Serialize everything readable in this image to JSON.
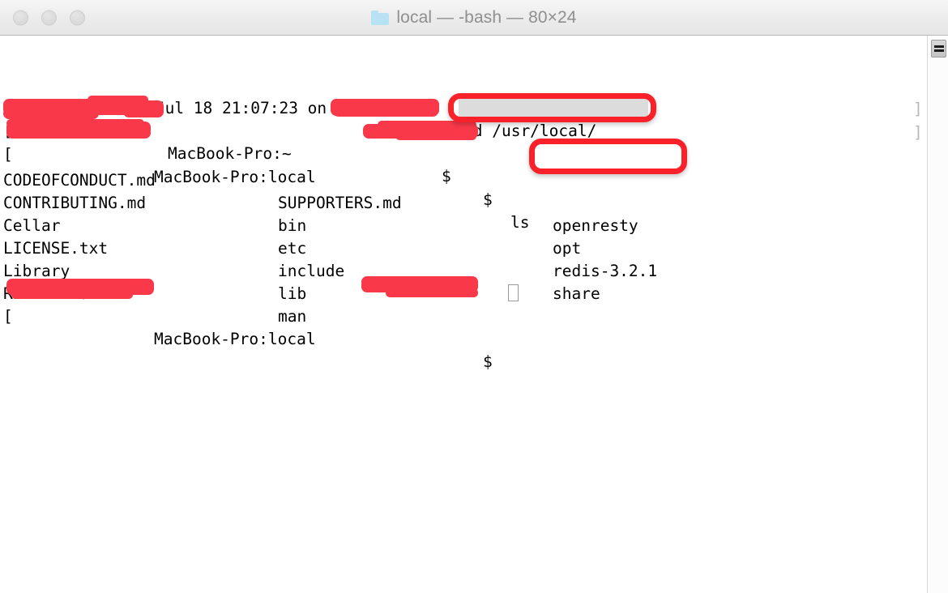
{
  "window": {
    "title": "local — -bash — 80×24",
    "folder_icon": "folder-icon",
    "traffic_lights": [
      {
        "name": "close-button",
        "label": "Close"
      },
      {
        "name": "minimize-button",
        "label": "Minimize"
      },
      {
        "name": "zoom-button",
        "label": "Zoom"
      }
    ]
  },
  "colors": {
    "annotation_red": "#f9212a",
    "redaction_red": "#f9394a",
    "terminal_bg": "#ffffff",
    "terminal_fg": "#000000",
    "selection_bg": "#dcdcdc",
    "title_text": "#8f8f8f",
    "folder_blue": "#b7e2f3"
  },
  "terminal": {
    "lines": [
      {
        "id": "line-last-login",
        "text": "Last login: Mon Jul 18 21:07:23 on ttys000"
      },
      {
        "id": "line-prompt-cd",
        "prefix": "[",
        "host": "MacBook-Pro:~ ",
        "sigil": "$ ",
        "command": "cd /usr/local/",
        "redacted": true
      },
      {
        "id": "line-prompt-ls",
        "prefix": "[",
        "host": "MacBook-Pro:local ",
        "sigil": "$ ",
        "command": "ls",
        "redacted": true
      },
      {
        "id": "line-prompt-final",
        "prefix": "[",
        "host": "MacBook-Pro:local ",
        "sigil": "$ ",
        "command": "",
        "redacted": true
      }
    ],
    "ls_output": {
      "column1": [
        "CODEOFCONDUCT.md",
        "CONTRIBUTING.md",
        "Cellar",
        "LICENSE.txt",
        "Library",
        "README.md"
      ],
      "column2": [
        "SUPPORTERS.md",
        "bin",
        "etc",
        "include",
        "lib",
        "man"
      ],
      "column3": [
        "openresty",
        "opt",
        "redis-3.2.1",
        "share"
      ]
    },
    "wrap_markers": [
      "]",
      "]"
    ],
    "cursor": "▯"
  },
  "annotations": [
    {
      "name": "annotation-cd-command",
      "target": "cd /usr/local/"
    },
    {
      "name": "annotation-openresty",
      "target": "openresty"
    }
  ],
  "scrollbar": {
    "thumb_label": "scroll-thumb"
  }
}
